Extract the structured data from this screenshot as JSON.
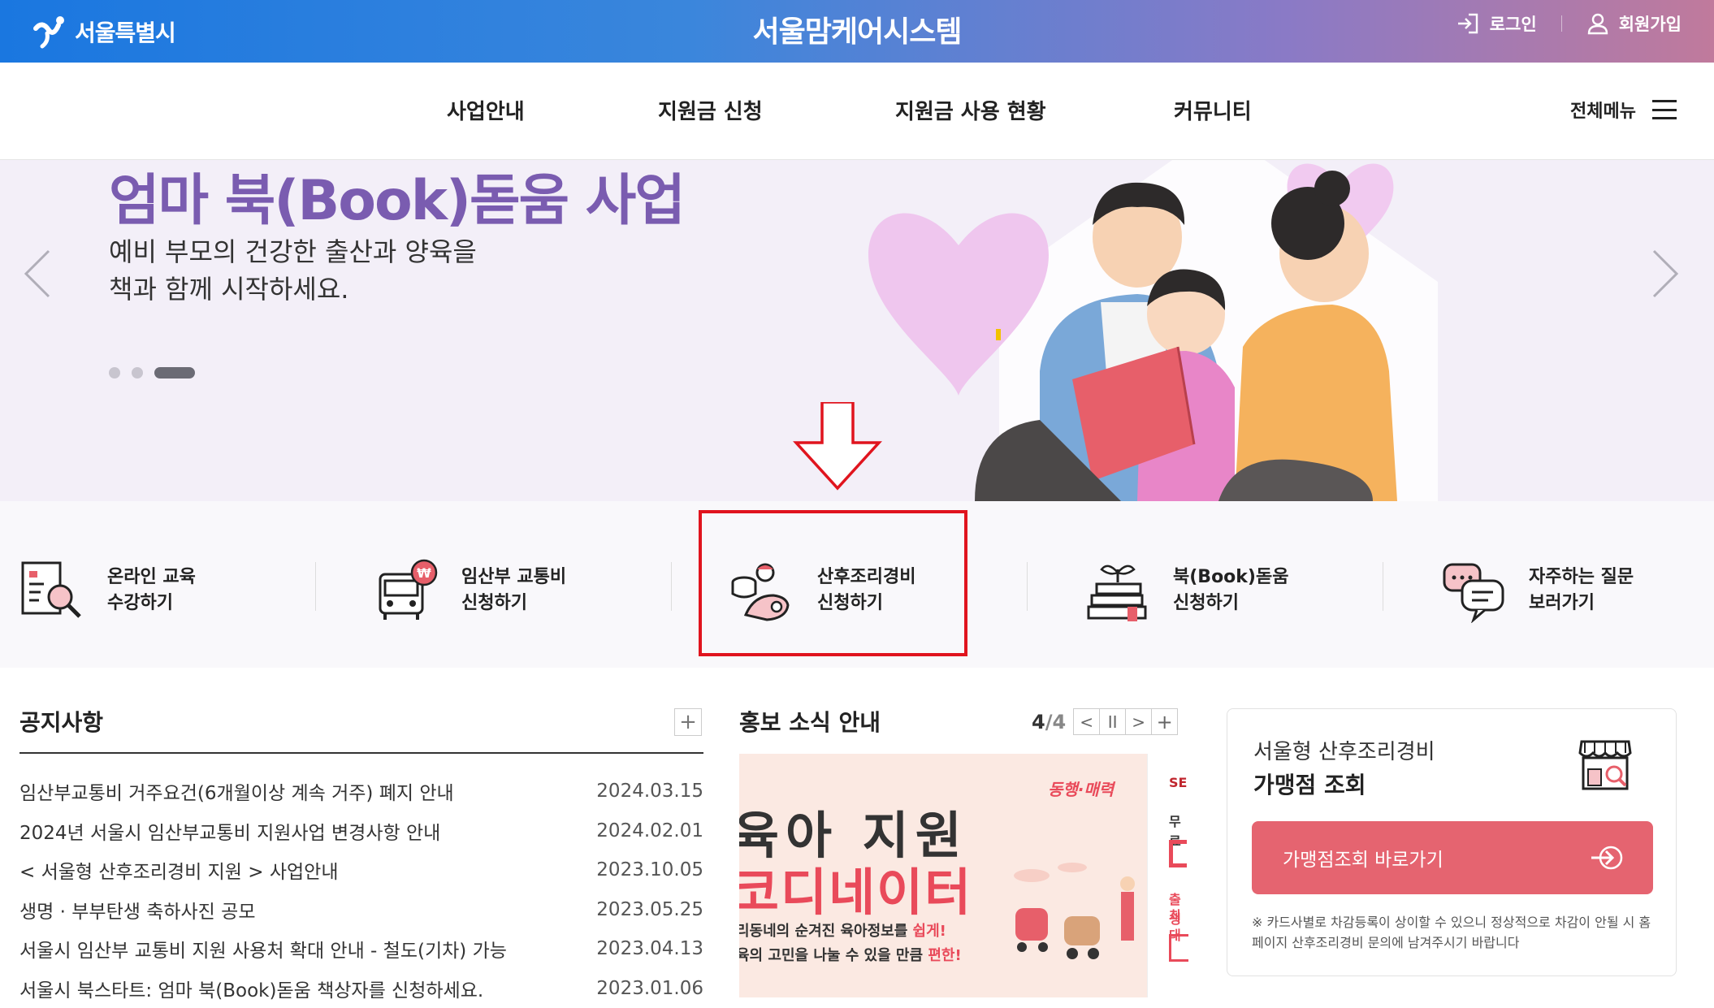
{
  "header": {
    "logo_text": "서울특별시",
    "site_title": "서울맘케어시스템",
    "login": "로그인",
    "signup": "회원가입"
  },
  "nav": {
    "items": [
      "사업안내",
      "지원금 신청",
      "지원금 사용 현황",
      "커뮤니티"
    ],
    "all_menu": "전체메뉴"
  },
  "hero": {
    "title": "엄마 북(Book)돋움 사업",
    "subtitle_line1": "예비 부모의 건강한 출산과 양육을",
    "subtitle_line2": "책과 함께 시작하세요.",
    "slide_count": 3,
    "active_slide": 3
  },
  "quick_links": [
    {
      "line1": "온라인 교육",
      "line2": "수강하기",
      "icon": "online-education-icon"
    },
    {
      "line1": "임산부 교통비",
      "line2": "신청하기",
      "icon": "bus-fare-icon"
    },
    {
      "line1": "산후조리경비",
      "line2": "신청하기",
      "icon": "postpartum-care-icon"
    },
    {
      "line1": "북(Book)돋움",
      "line2": "신청하기",
      "icon": "book-plant-icon"
    },
    {
      "line1": "자주하는 질문",
      "line2": "보러가기",
      "icon": "faq-chat-icon"
    }
  ],
  "notice": {
    "title": "공지사항",
    "more": "+",
    "items": [
      {
        "title": "임산부교통비 거주요건(6개월이상 계속 거주) 폐지 안내",
        "date": "2024.03.15"
      },
      {
        "title": "2024년 서울시 임산부교통비 지원사업 변경사항 안내",
        "date": "2024.02.01"
      },
      {
        "title": "< 서울형 산후조리경비 지원 > 사업안내",
        "date": "2023.10.05"
      },
      {
        "title": "생명 · 부부탄생 축하사진 공모",
        "date": "2023.05.25"
      },
      {
        "title": "서울시 임산부 교통비 지원 사용처 확대 안내 - 철도(기차) 가능",
        "date": "2023.04.13"
      },
      {
        "title": "서울시 북스타트: 엄마 북(Book)돋움 책상자를 신청하세요.",
        "date": "2023.01.06"
      }
    ]
  },
  "promo": {
    "title": "홍보 소식 안내",
    "current": "4",
    "total": "/4",
    "prev": "<",
    "pause": "II",
    "next": ">",
    "more": "+",
    "banner_big1": "육아 지원",
    "banner_big2": "코디네이터",
    "banner_small1_a": "리동네의 순겨진 육아정보를 ",
    "banner_small1_b": "쉽게!",
    "banner_small2_a": "육의 고민을 나눌 수 있을 만큼 ",
    "banner_small2_b": "편한!",
    "banner_brand": "동행·매력",
    "side_lines": [
      "SE",
      "무료",
      "출생",
      "최대"
    ]
  },
  "store": {
    "title1": "서울형 산후조리경비",
    "title2": "가맹점 조회",
    "button": "가맹점조회 바로가기",
    "note": "※ 카드사별로 차감등록이 상이할 수 있으니 정상적으로 차감이 안될 시 홈페이지 산후조리경비 문의에 남겨주시기 바랍니다"
  }
}
